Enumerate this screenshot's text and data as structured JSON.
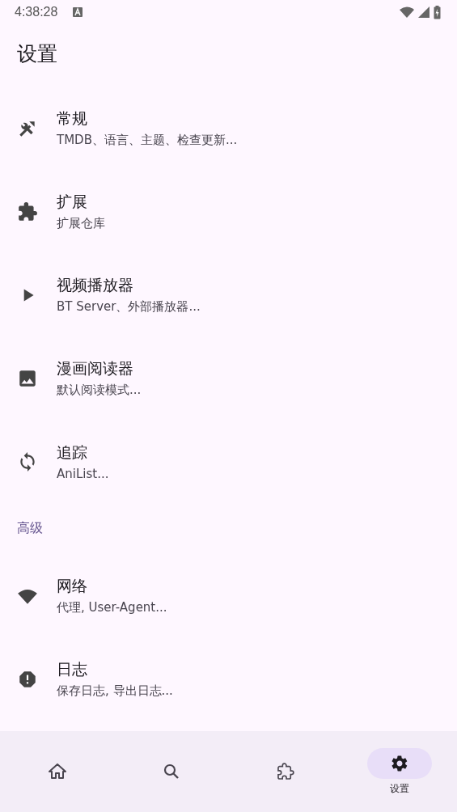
{
  "status_bar": {
    "time": "4:38:28"
  },
  "title": "设置",
  "sections": [
    {
      "items": [
        {
          "title": "常规",
          "subtitle": "TMDB、语言、主题、检查更新..."
        },
        {
          "title": "扩展",
          "subtitle": "扩展仓库"
        },
        {
          "title": "视频播放器",
          "subtitle": "BT Server、外部播放器..."
        },
        {
          "title": "漫画阅读器",
          "subtitle": "默认阅读模式..."
        },
        {
          "title": "追踪",
          "subtitle": "AniList..."
        }
      ]
    },
    {
      "header": "高级",
      "items": [
        {
          "title": "网络",
          "subtitle": "代理, User-Agent..."
        },
        {
          "title": "日志",
          "subtitle": "保存日志, 导出日志..."
        }
      ]
    }
  ],
  "nav": [
    {
      "selected": false
    },
    {
      "selected": false
    },
    {
      "selected": false
    },
    {
      "selected": true,
      "label": "设置"
    }
  ]
}
